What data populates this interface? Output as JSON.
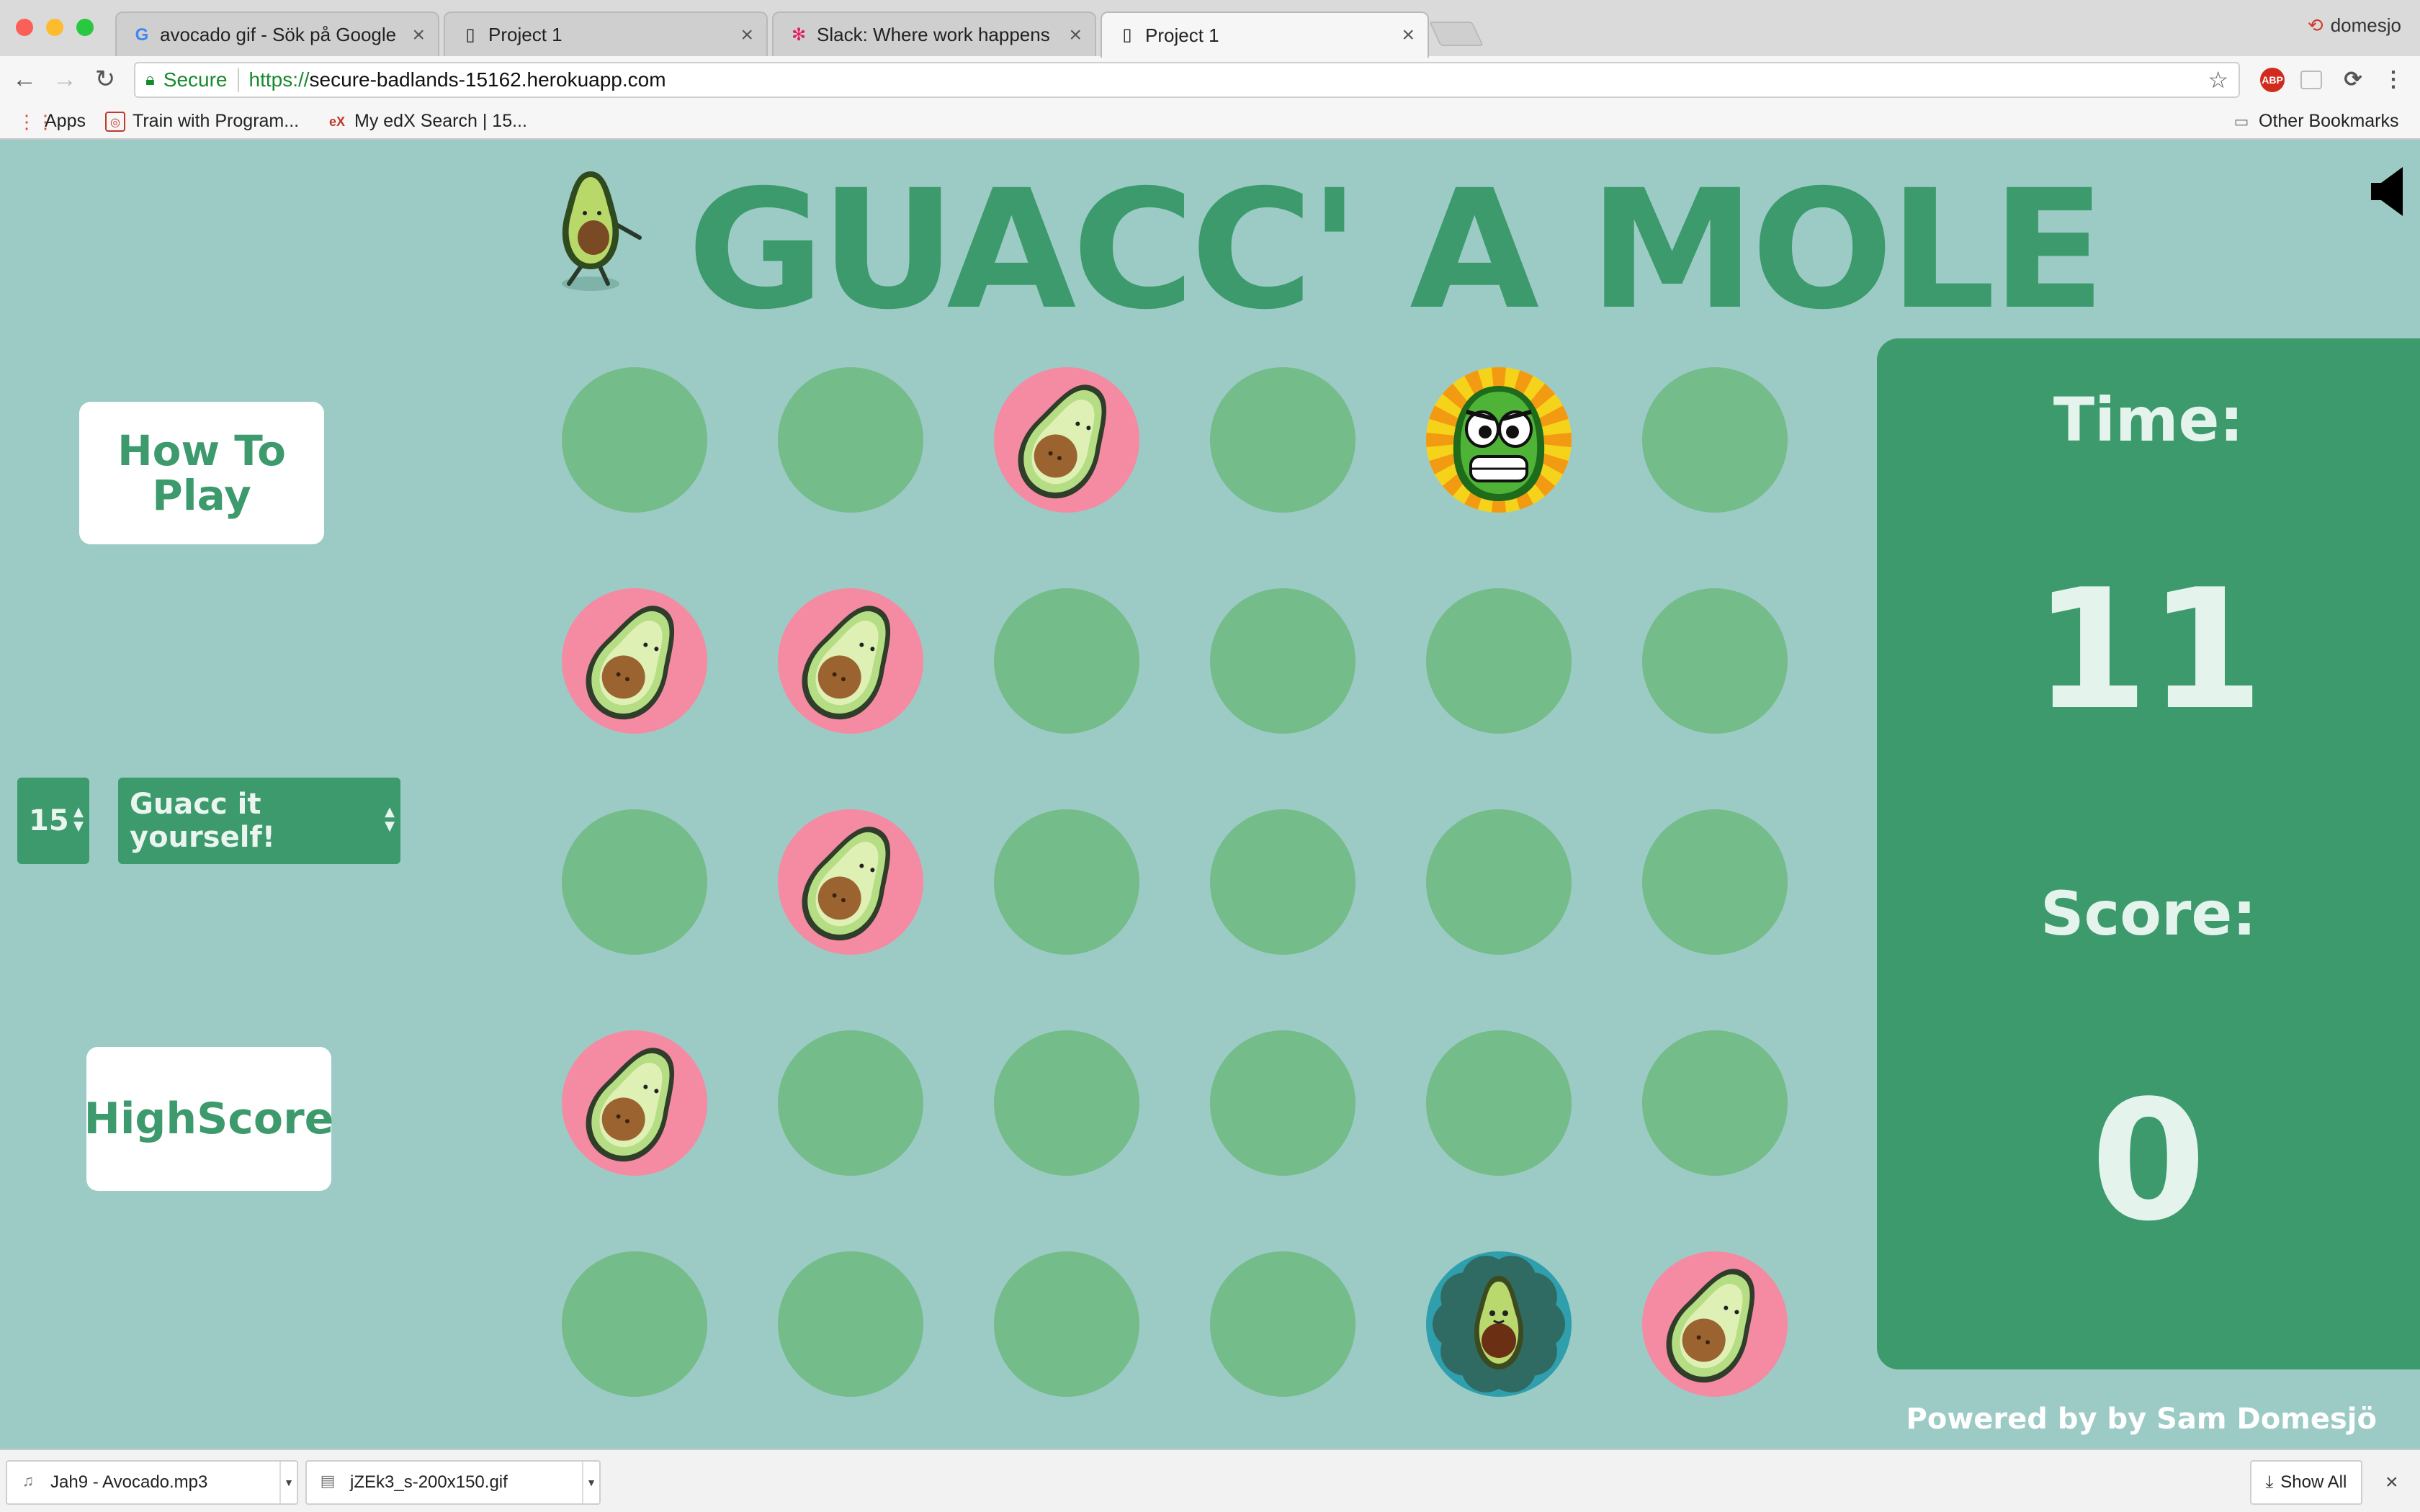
{
  "browser": {
    "tabs": [
      {
        "title": "avocado gif - Sök på Google",
        "icon": "google-icon",
        "active": false
      },
      {
        "title": "Project 1",
        "icon": "page-icon",
        "active": false
      },
      {
        "title": "Slack: Where work happens",
        "icon": "slack-icon",
        "active": false
      },
      {
        "title": "Project 1",
        "icon": "page-icon",
        "active": true
      }
    ],
    "profile_name": "domesjo",
    "secure_label": "Secure",
    "url_proto": "https://",
    "url_host": "secure-badlands-15162.herokuapp.com",
    "bookmarks": [
      {
        "label": "Apps",
        "icon": "apps-grid-icon"
      },
      {
        "label": "Train with Program...",
        "icon": "bookmark-site-icon"
      },
      {
        "label": "My edX Search | 15...",
        "icon": "edx-icon"
      }
    ],
    "other_bookmarks": "Other Bookmarks",
    "ext_abp": "ABP"
  },
  "game": {
    "title": "GUACC' A MOLE",
    "how_to_play": "How To Play",
    "how_to_play_line1": "How To",
    "how_to_play_line2": "Play",
    "time_select_value": "15",
    "mode_select_value": "Guacc it yourself!",
    "highscore": "HighScore",
    "time_label": "Time:",
    "time_value": "11",
    "score_label": "Score:",
    "score_value": "0",
    "powered_by": "Powered by by Sam Domesjö",
    "colors": {
      "background": "#9ccbc6",
      "accent": "#3c9a6d",
      "hole": "#74bc89",
      "avocado_bg": "#f48ba2"
    },
    "grid": [
      [
        "empty",
        "empty",
        "avocado",
        "empty",
        "angry-mole",
        "empty"
      ],
      [
        "avocado",
        "avocado",
        "empty",
        "empty",
        "empty",
        "empty"
      ],
      [
        "empty",
        "avocado",
        "empty",
        "empty",
        "empty",
        "empty"
      ],
      [
        "avocado",
        "empty",
        "empty",
        "empty",
        "empty",
        "empty"
      ],
      [
        "empty",
        "empty",
        "empty",
        "empty",
        "golden-avocado",
        "avocado"
      ]
    ]
  },
  "downloads": [
    {
      "name": "Jah9 - Avocado.mp3",
      "icon": "audio-file-icon"
    },
    {
      "name": "jZEk3_s-200x150.gif",
      "icon": "image-file-icon"
    }
  ],
  "show_all": "Show All"
}
